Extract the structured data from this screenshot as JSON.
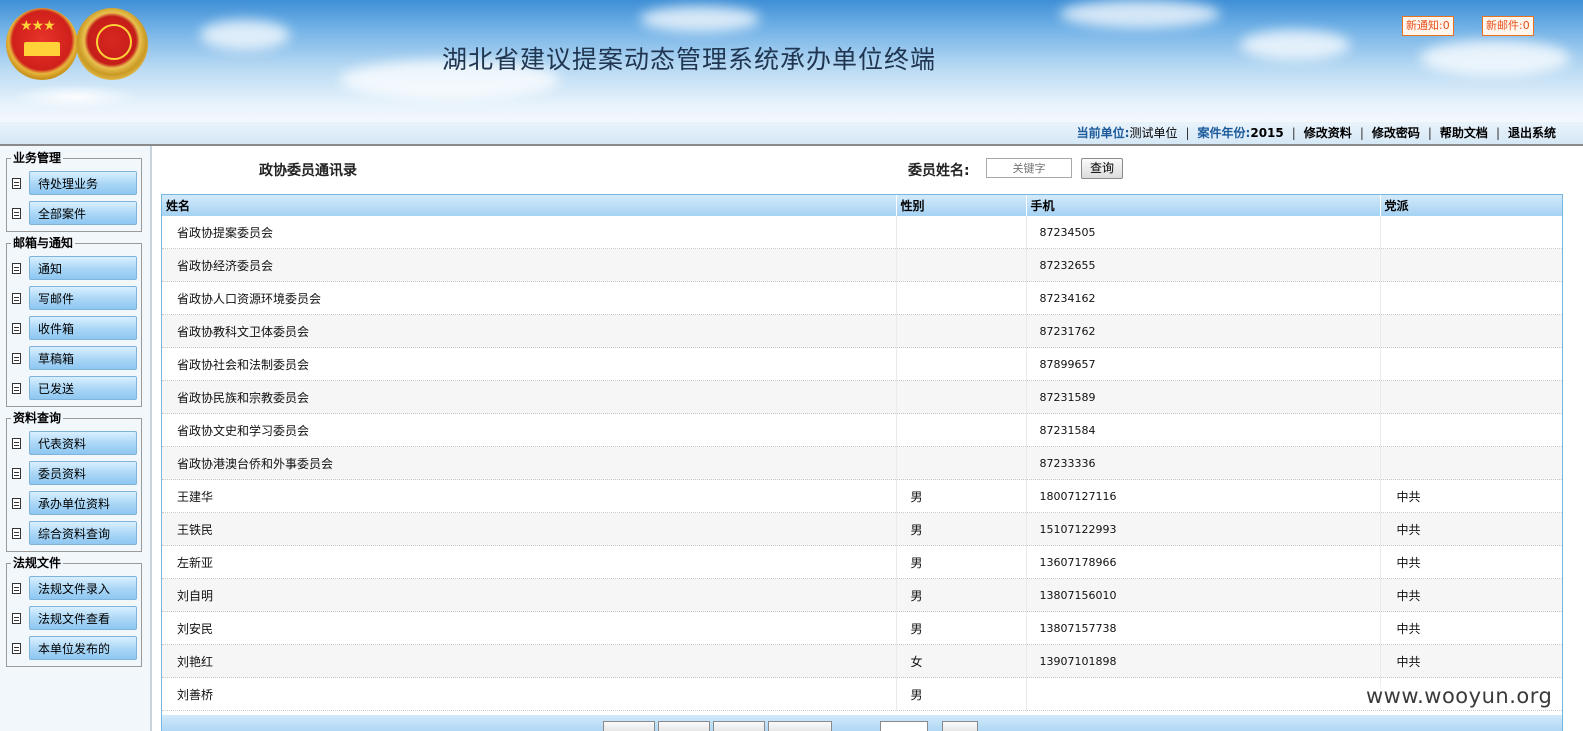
{
  "header": {
    "title": "湖北省建议提案动态管理系统承办单位终端",
    "new_notice": "新通知:0",
    "new_mail": "新邮件:0"
  },
  "infobar": {
    "unit_label": "当前单位:",
    "unit_value": "测试单位",
    "year_label": "案件年份:",
    "year_value": "2015",
    "links": [
      "修改资料",
      "修改密码",
      "帮助文档",
      "退出系统"
    ]
  },
  "sidebar": {
    "groups": [
      {
        "title": "业务管理",
        "items": [
          "待处理业务",
          "全部案件"
        ]
      },
      {
        "title": "邮箱与通知",
        "items": [
          "通知",
          "写邮件",
          "收件箱",
          "草稿箱",
          "已发送"
        ]
      },
      {
        "title": "资料查询",
        "items": [
          "代表资料",
          "委员资料",
          "承办单位资料",
          "综合资料查询"
        ]
      },
      {
        "title": "法规文件",
        "items": [
          "法规文件录入",
          "法规文件查看",
          "本单位发布的"
        ]
      }
    ]
  },
  "main": {
    "title": "政协委员通讯录",
    "search_label": "委员姓名:",
    "search_placeholder": "关键字",
    "search_button": "查询",
    "columns": [
      "姓名",
      "性别",
      "手机",
      "党派"
    ],
    "rows": [
      [
        "省政协提案委员会",
        "",
        "87234505",
        ""
      ],
      [
        "省政协经济委员会",
        "",
        "87232655",
        ""
      ],
      [
        "省政协人口资源环境委员会",
        "",
        "87234162",
        ""
      ],
      [
        "省政协教科文卫体委员会",
        "",
        "87231762",
        ""
      ],
      [
        "省政协社会和法制委员会",
        "",
        "87899657",
        ""
      ],
      [
        "省政协民族和宗教委员会",
        "",
        "87231589",
        ""
      ],
      [
        "省政协文史和学习委员会",
        "",
        "87231584",
        ""
      ],
      [
        "省政协港澳台侨和外事委员会",
        "",
        "87233336",
        ""
      ],
      [
        "王建华",
        "男",
        "18007127116",
        "中共"
      ],
      [
        "王铁民",
        "男",
        "15107122993",
        "中共"
      ],
      [
        "左新亚",
        "男",
        "13607178966",
        "中共"
      ],
      [
        "刘自明",
        "男",
        "13807156010",
        "中共"
      ],
      [
        "刘安民",
        "男",
        "13807157738",
        "中共"
      ],
      [
        "刘艳红",
        "女",
        "13907101898",
        "中共"
      ],
      [
        "刘善桥",
        "男",
        "",
        ""
      ]
    ]
  },
  "watermark": "www.wooyun.org"
}
